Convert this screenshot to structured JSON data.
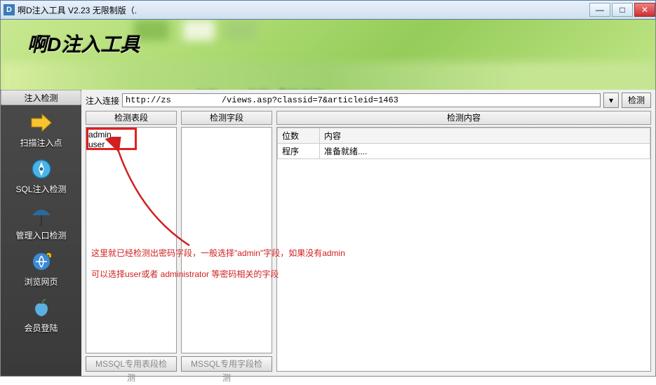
{
  "titlebar": {
    "icon_letter": "D",
    "title": "啊D注入工具 V2.23 无限制版（."
  },
  "banner": {
    "title": "啊D注入工具"
  },
  "sidebar": {
    "header": "注入检测",
    "items": [
      {
        "label": "扫描注入点",
        "icon": "arrow"
      },
      {
        "label": "SQL注入检测",
        "icon": "compass"
      },
      {
        "label": "管理入口检测",
        "icon": "umbrella"
      },
      {
        "label": "浏览网页",
        "icon": "ie"
      },
      {
        "label": "会员登陆",
        "icon": "apple"
      }
    ]
  },
  "url": {
    "label": "注入连接",
    "value": "http://zs          /views.asp?classid=7&articleid=1463",
    "detect_btn": "检测",
    "dropdown": "▾"
  },
  "panels": {
    "tables_hdr": "检测表段",
    "fields_hdr": "检测字段",
    "content_hdr": "检测内容",
    "tables": [
      "admin",
      "user"
    ],
    "content_cols": {
      "count": "位数",
      "content": "内容"
    },
    "content_row": {
      "count": "程序",
      "content": "准备就绪...."
    },
    "btn_mssql_table": "MSSQL专用表段检测",
    "btn_mssql_field": "MSSQL专用字段检测"
  },
  "annotation": {
    "line1": "这里就已经检测出密码字段，一般选择\"admin\"字段，如果没有admin",
    "line2": "可以选择user或者 administrator 等密码相关的字段"
  }
}
